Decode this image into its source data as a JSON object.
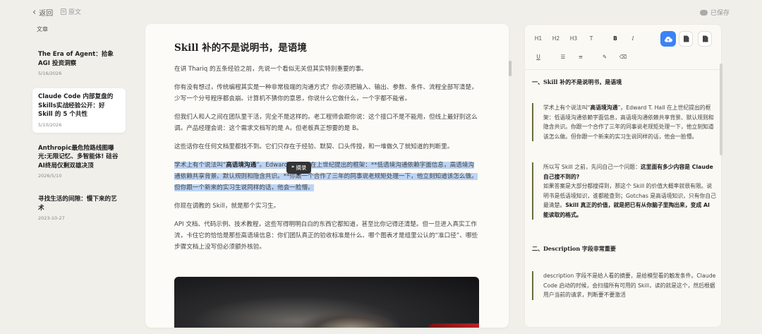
{
  "topbar": {
    "back_label": "返回",
    "origin_label": "原文",
    "saved_label": "已保存"
  },
  "sidebar": {
    "label": "文章",
    "articles": [
      {
        "title": "The Era of Agent：拾象 AGI 投资洞察",
        "date": "5/16/2026"
      },
      {
        "title": "Claude Code 内部复盘的Skills实战经验公开：好 Skill 的 5 个共性",
        "date": "5/10/2026"
      },
      {
        "title": "Anthropic最危险路线图曝光:无限记忆、多智能体! 硅谷AI终局仅剩双雄决顶",
        "date": "2026/5/10"
      },
      {
        "title": "寻找生活的间隙：慢下来的艺术",
        "date": "2023-10-27"
      }
    ]
  },
  "editor": {
    "title": "Skill 补的不是说明书，是语境",
    "p1": "在讲 Thariq 的五条经验之前，先说一个看似无关但其实特别重要的事。",
    "p2": "你有没有想过，传统编程其实是一种非常极端的沟通方式？你必须把输入、输出、参数、条件、流程全部写清楚，少写一个分号程序都会崩。计算机不猜你的意思，你说什么它做什么，一个字都不能省。",
    "p3": "但我们人和人之间在团队里干活，完全不是这样的。老工程师会跟你说：这个接口不是不能用，但线上最好别这么调。产品经理会说：这个需求文档写的是 A，但老板真正想要的是 B。",
    "p4": "这些话你在任何文档里都找不到。它们只存在于经验、默契、口头传授，和一堆做久了就知道的判断里。",
    "p5_a": "学术上有个说法叫“",
    "p5_b": "高语境沟通",
    "p5_c": "”。Edward T. Hall 在上世纪提出的框架：**低语境沟通依赖字面信息，高语境沟通依赖共享背景、默认规则和隐含共识。**你跟一个合作了三年的同事说老规矩处理一下，他立刻知道该怎么做。但你跟一个新来的实习生说同样的话，他会一脸懵。",
    "tooltip": "摘录",
    "p6": "你现在调教的 Skill，就是那个实习生。",
    "p7": "API 文档、代码示例、技术教程，这些写得明明白白的东西它都知道，甚至比你记得还清楚。但一旦进入真实工作流，卡住它的恰恰是那些高语境信息：你们团队真正的验收标准是什么、哪个图表才是组里公认的“准口径”、哪些步骤文档上没写但必须额外核验。"
  },
  "toolbar": {
    "h1": "H1",
    "h2": "H2",
    "h3": "H3",
    "t": "T",
    "bold": "B",
    "italic": "I",
    "underline": "U"
  },
  "excerpts": {
    "h1": "一、Skill 补的不是说明书，是语境",
    "q1_a": "学术上有个说法叫“",
    "q1_b": "高语境沟通",
    "q1_c": "”。Edward T. Hall 在上世纪提出的框架：低语境沟通依赖字面信息，高语境沟通依赖共享背景、默认规则和隐含共识。你跟一个合作了三年的同事说老规矩处理一下，他立刻知道该怎么做。但你跟一个新来的实习生说同样的话，他会一脸懵。",
    "q2_a": "所以写 Skill 之前，先问自己一个问题：",
    "q2_b": "这里面有多少内容是 Claude 自己搜不到的?",
    "q2_c": "如果答案是大部分都搜得到，那这个 Skill 的价值大概率就很有限。说明书是低语境知识，谁都能查到；Gotchas 是高语境知识，只有你自己最清楚。",
    "q2_d": "Skill 真正的价值，就是把已有从你脑子里掏出来，变成 AI 能读取的格式。",
    "h2": "二、Description 字段非常重要",
    "q3": "description 字段不是给人看的摘要，是给模型看的触发条件。Claude Code 启动的时候，会扫描所有可用的 Skill，读的就是这个，然后根据用户当前的请求，判断要不要激活"
  },
  "colors": {
    "accent": "#3b82f6",
    "highlight": "#bcd4f5",
    "quote_bar": "#6b6e3a"
  }
}
